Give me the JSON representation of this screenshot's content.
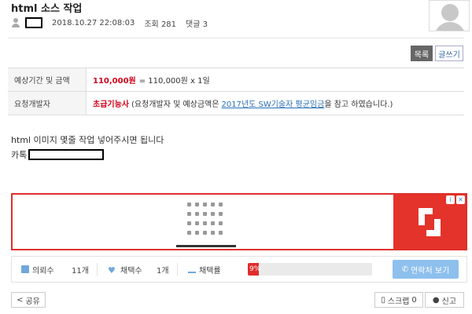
{
  "post": {
    "title": "html 소스 작업",
    "datetime": "2018.10.27 22:08:03",
    "views_label": "조회 281",
    "comments_label": "댓글 3"
  },
  "actions": {
    "list_label": "목록",
    "write_label": "글쓰기"
  },
  "info": {
    "period_label": "예상기간 및 금액",
    "price": "110,000원",
    "price_detail": "= 110,000원 x 1일",
    "developer_label": "요청개발자",
    "developer_level": "초급기능사",
    "developer_note_prefix": "(요청개발자 및 예상금액은",
    "developer_note_link": "2017년도 SW기술자 평균임금",
    "developer_note_suffix": "을 참고 하였습니다.)"
  },
  "body": {
    "line1": "html 이미지 몇줄 작업 넣어주시면 됩니다",
    "line2_prefix": "카톡"
  },
  "stats": {
    "views_label": "의뢰수",
    "views_value": "11개",
    "picks_label": "채택수",
    "picks_value": "1개",
    "rate_label": "채택률",
    "rate_text": "9%",
    "rate_value": 0.09,
    "contact_label": "연락처 보기"
  },
  "footer": {
    "share_label": "공유",
    "scrap_label": "스크랩",
    "scrap_count": "0",
    "report_label": "신고"
  },
  "colors": {
    "accent_red": "#d0021b",
    "link_blue": "#2a6fb8",
    "contact_button": "#8ec0ee",
    "ad_red": "#e4332b"
  },
  "icons": [
    "user-icon",
    "avatar-placeholder",
    "view-icon",
    "heart-icon",
    "bar-chart-icon",
    "phone-icon",
    "share-icon",
    "bookmark-icon",
    "person-icon",
    "ad-info-icon",
    "ad-close-icon"
  ]
}
